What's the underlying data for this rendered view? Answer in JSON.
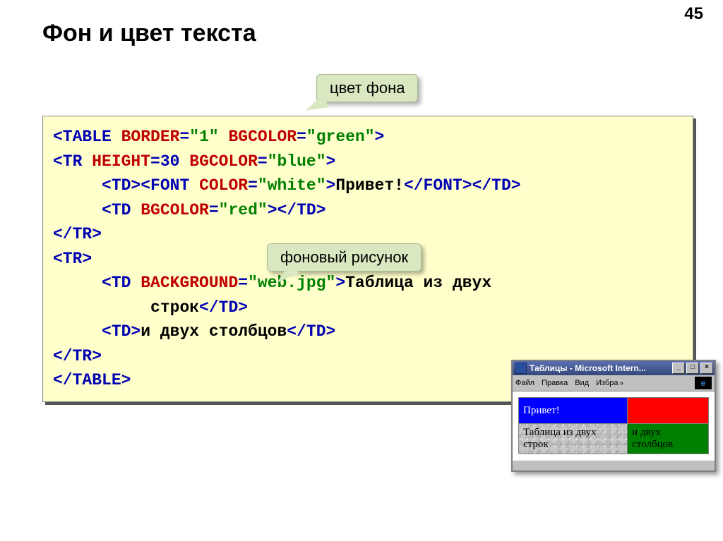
{
  "page_number": "45",
  "title": "Фон и цвет текста",
  "callouts": {
    "bgcolor": "цвет фона",
    "background": "фоновый рисунок"
  },
  "code": {
    "line1": {
      "tag_open": "<TABLE ",
      "a1": "BORDER",
      "e1": "=",
      "v1": "\"1\" ",
      "a2": "BGCOLOR",
      "e2": "=",
      "v2": "\"green\"",
      "tag_close": ">"
    },
    "line2": {
      "tag_open": "<TR ",
      "a1": "HEIGHT",
      "e1": "=30 ",
      "a2": "BGCOLOR",
      "e2": "=",
      "v2": "\"blue\"",
      "tag_close": ">"
    },
    "line3": {
      "indent": "     ",
      "td_open": "<TD>",
      "font_open": "<FONT ",
      "a1": "COLOR",
      "e1": "=",
      "v1": "\"white\"",
      "gt": ">",
      "text": "Привет!",
      "font_close": "</FONT>",
      "td_close": "</TD>"
    },
    "line4": {
      "indent": "     ",
      "td_open": "<TD ",
      "a1": "BGCOLOR",
      "e1": "=",
      "v1": "\"red\"",
      "gt": ">",
      "td_close": "</TD>"
    },
    "line5": {
      "tag": "</TR>"
    },
    "line6": {
      "tag": "<TR>"
    },
    "line7": {
      "indent": "     ",
      "td_open": "<TD ",
      "a1": "BACKGROUND",
      "e1": "=",
      "v1": "\"web.jpg\"",
      "gt": ">",
      "text1": "Таблица из двух",
      "indent2": "          ",
      "text2": "строк",
      "td_close": "</TD>"
    },
    "line8": {
      "indent": "     ",
      "td_open": "<TD>",
      "text": "и двух столбцов",
      "td_close": "</TD>"
    },
    "line9": {
      "tag": "</TR>"
    },
    "line10": {
      "tag": "</TABLE>"
    }
  },
  "mini_window": {
    "title": "Таблицы - Microsoft Intern...",
    "menu": {
      "file": "Файл",
      "edit": "Правка",
      "view": "Вид",
      "fav": "Избра"
    },
    "cells": {
      "c1": "Привет!",
      "c3": "Таблица из двух строк",
      "c4": "и двух столбцов"
    }
  }
}
